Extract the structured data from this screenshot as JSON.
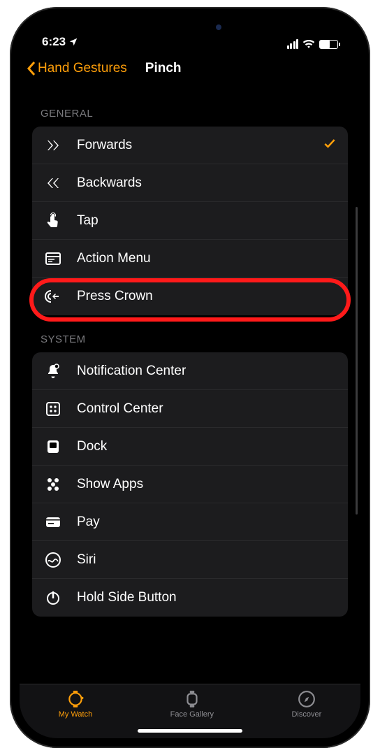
{
  "status": {
    "time": "6:23"
  },
  "nav": {
    "back": "Hand Gestures",
    "title": "Pinch"
  },
  "sections": {
    "general": {
      "header": "GENERAL",
      "forwards": "Forwards",
      "backwards": "Backwards",
      "tap": "Tap",
      "actionmenu": "Action Menu",
      "presscrown": "Press Crown"
    },
    "system": {
      "header": "SYSTEM",
      "notif": "Notification Center",
      "control": "Control Center",
      "dock": "Dock",
      "showapps": "Show Apps",
      "applepay": "Pay",
      "siri": "Siri",
      "holdside": "Hold Side Button"
    }
  },
  "tabs": {
    "mywatch": "My Watch",
    "gallery": "Face Gallery",
    "discover": "Discover"
  }
}
